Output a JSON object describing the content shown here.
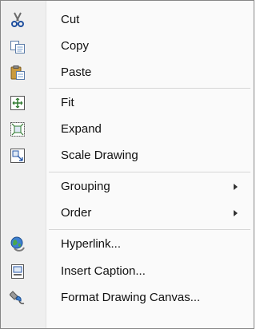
{
  "menu": {
    "items": [
      {
        "label": "Cut",
        "icon": "scissors-icon"
      },
      {
        "label": "Copy",
        "icon": "copy-icon"
      },
      {
        "label": "Paste",
        "icon": "paste-clipboard-icon"
      },
      {
        "label": "Fit",
        "icon": "fit-canvas-icon"
      },
      {
        "label": "Expand",
        "icon": "expand-canvas-icon"
      },
      {
        "label": "Scale Drawing",
        "icon": "scale-drawing-icon"
      },
      {
        "label": "Grouping",
        "submenu": true
      },
      {
        "label": "Order",
        "submenu": true
      },
      {
        "label": "Hyperlink...",
        "icon": "hyperlink-globe-icon"
      },
      {
        "label": "Insert Caption...",
        "icon": "caption-icon"
      },
      {
        "label": "Format Drawing Canvas...",
        "icon": "format-canvas-icon"
      }
    ]
  },
  "colors": {
    "gutter": "#efefef",
    "menu_bg": "#fafafa",
    "border": "#868686",
    "separator": "#d6d6d6"
  }
}
